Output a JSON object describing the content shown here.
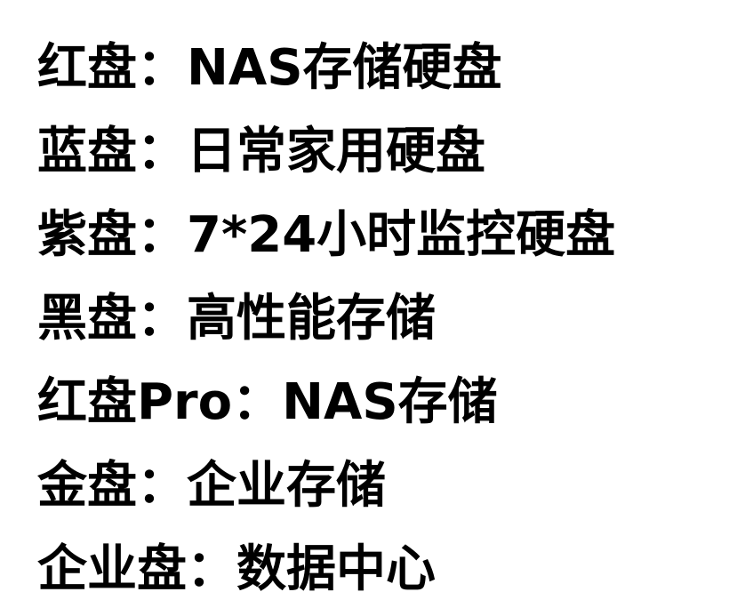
{
  "lines": [
    "红盘：NAS存储硬盘",
    "蓝盘：日常家用硬盘",
    "紫盘：7*24小时监控硬盘",
    "黑盘：高性能存储",
    "红盘Pro：NAS存储",
    "金盘：企业存储",
    "企业盘：数据中心"
  ]
}
